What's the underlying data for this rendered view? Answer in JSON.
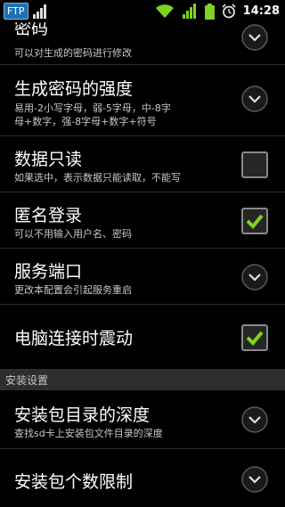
{
  "status_bar": {
    "app_badge": "FTP",
    "time": "14:28",
    "icons": [
      "ftp-notification-icon",
      "signal-small-icon",
      "wifi-icon",
      "cell-signal-icon",
      "battery-icon",
      "alarm-icon"
    ],
    "accent": "#1f6fb3"
  },
  "settings": {
    "items": [
      {
        "title": "密码",
        "summary": "可以对生成的密码进行修改",
        "widget": "chevron"
      },
      {
        "title": "生成密码的强度",
        "summary": "易用-2小写字母，弱-5字母，中-8字母+数字，强-8字母+数字+符号",
        "summary_line1": "易用-2小写字母，弱-5字母，中-8字",
        "summary_line2": "母+数字，强-8字母+数字+符号",
        "widget": "chevron"
      },
      {
        "title": "数据只读",
        "summary": "如果选中，表示数据只能读取，不能写",
        "widget": "checkbox",
        "checked": false
      },
      {
        "title": "匿名登录",
        "summary": "可以不用输入用户名、密码",
        "widget": "checkbox",
        "checked": true
      },
      {
        "title": "服务端口",
        "summary": "更改本配置会引起服务重启",
        "widget": "chevron"
      },
      {
        "title": "电脑连接时震动",
        "summary": "",
        "widget": "checkbox",
        "checked": true
      }
    ],
    "section_header": "安装设置",
    "install_items": [
      {
        "title": "安装包目录的深度",
        "summary": "查找sd卡上安装包文件目录的深度",
        "widget": "chevron"
      },
      {
        "title": "安装包个数限制",
        "summary": "",
        "widget": "chevron"
      }
    ]
  },
  "colors": {
    "check_green": "#7ed321",
    "background": "#000000",
    "section_bg": "#2e2e2e"
  }
}
